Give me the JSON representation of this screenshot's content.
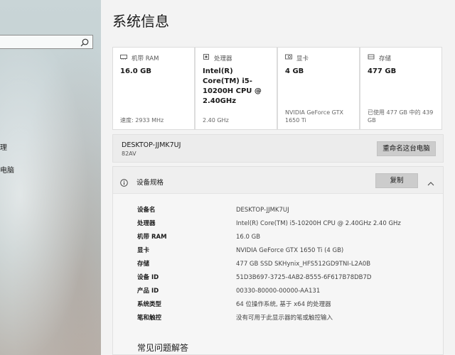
{
  "sidebar": {
    "search_placeholder": "",
    "items": [
      {
        "label": "理"
      },
      {
        "label": "电脑"
      }
    ]
  },
  "page": {
    "title": "系统信息"
  },
  "cards": [
    {
      "icon": "memory-icon",
      "label": "机带 RAM",
      "value": "16.0 GB",
      "sub": "速度: 2933 MHz"
    },
    {
      "icon": "processor-icon",
      "label": "处理器",
      "value": "Intel(R) Core(TM) i5-10200H CPU @ 2.40GHz",
      "sub": "2.40 GHz"
    },
    {
      "icon": "graphics-card-icon",
      "label": "显卡",
      "value": "4 GB",
      "sub": "NVIDIA GeForce GTX 1650 Ti"
    },
    {
      "icon": "storage-icon",
      "label": "存储",
      "value": "477 GB",
      "sub": "已使用 477 GB 中的 439 GB"
    }
  ],
  "device": {
    "name": "DESKTOP-JJMK7UJ",
    "model": "82AV",
    "rename_label": "重命名这台电脑"
  },
  "specs": {
    "title": "设备规格",
    "copy_label": "复制",
    "rows": [
      {
        "label": "设备名",
        "value": "DESKTOP-JJMK7UJ"
      },
      {
        "label": "处理器",
        "value": "Intel(R) Core(TM) i5-10200H CPU @ 2.40GHz   2.40 GHz"
      },
      {
        "label": "机带 RAM",
        "value": "16.0 GB"
      },
      {
        "label": "显卡",
        "value": "NVIDIA GeForce GTX 1650 Ti (4 GB)"
      },
      {
        "label": "存储",
        "value": "477 GB SSD SKHynix_HFS512GD9TNI-L2A0B"
      },
      {
        "label": "设备 ID",
        "value": "51D3B697-3725-4AB2-B555-6F617B78DB7D"
      },
      {
        "label": "产品 ID",
        "value": "00330-80000-00000-AA131"
      },
      {
        "label": "系统类型",
        "value": "64 位操作系统, 基于 x64 的处理器"
      },
      {
        "label": "笔和触控",
        "value": "没有可用于此显示器的笔或触控输入"
      }
    ],
    "faq_title": "常见问题解答"
  }
}
